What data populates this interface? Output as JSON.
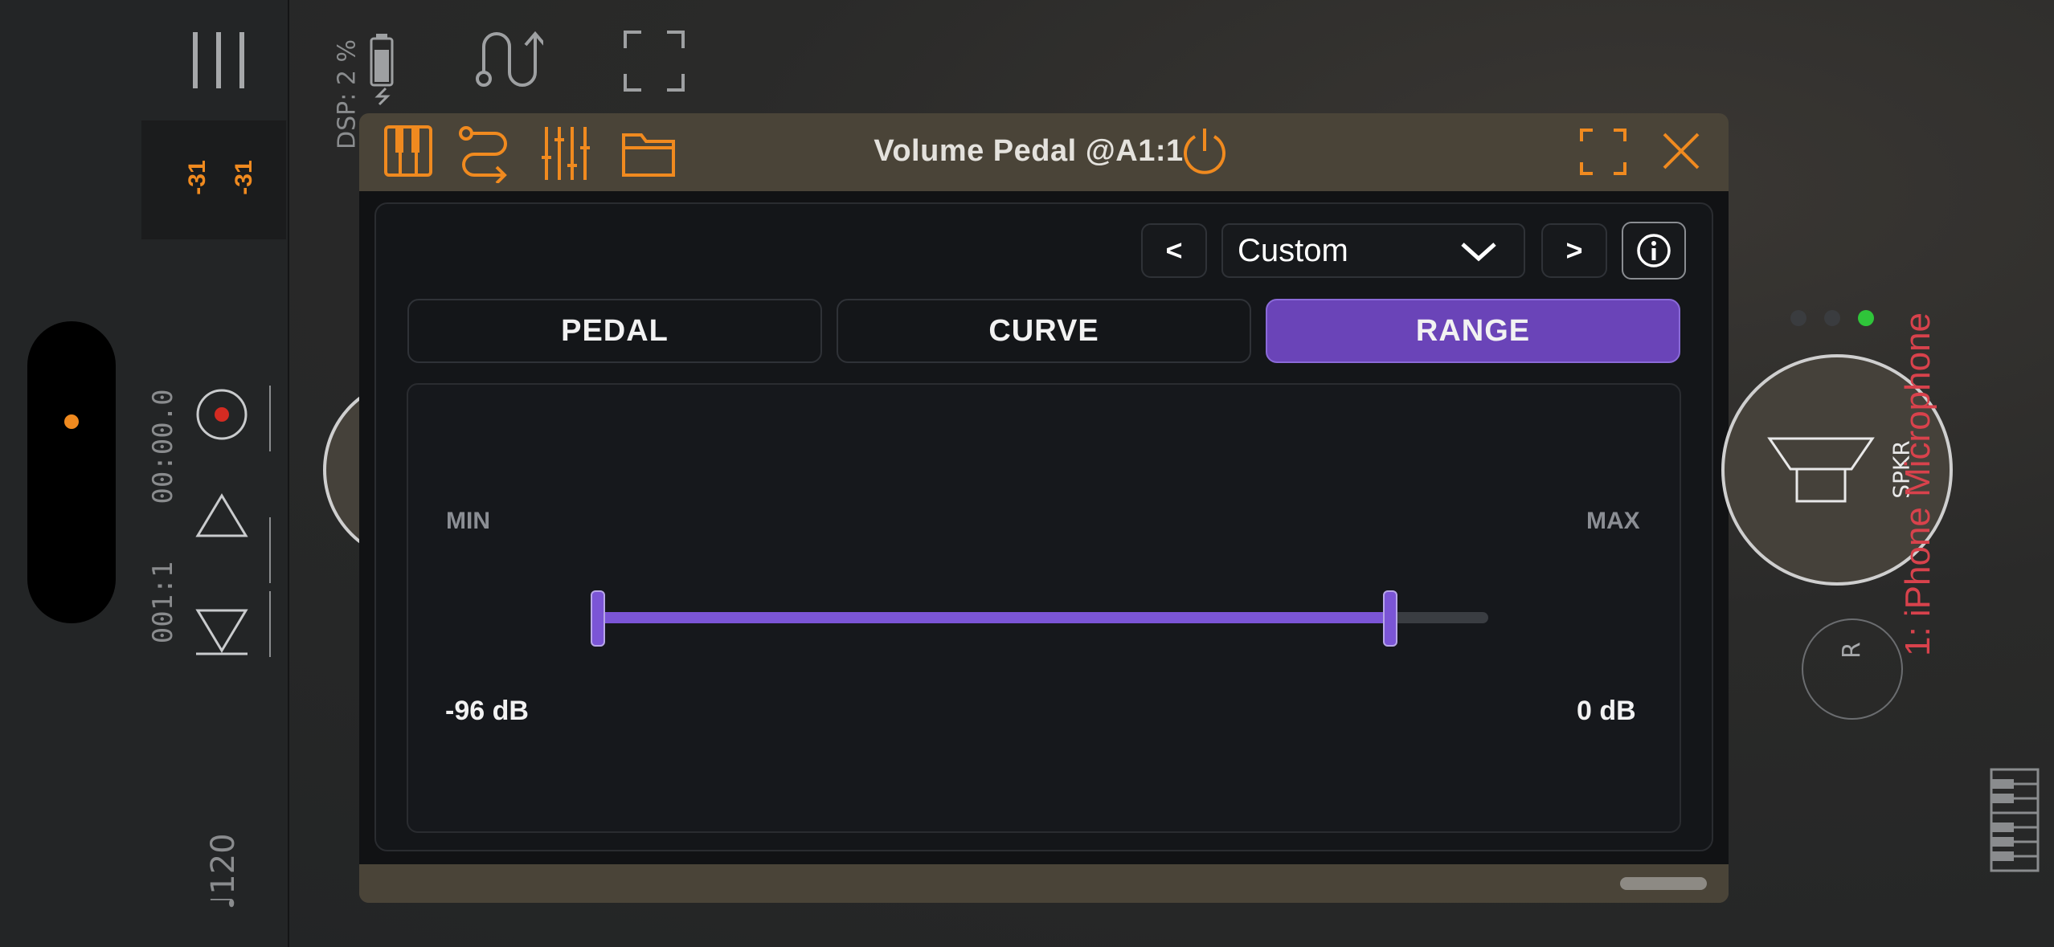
{
  "app": {
    "dsp_label": "DSP: 2 %",
    "meter_left": "-31",
    "meter_right": "-31",
    "time": "00:00.0",
    "position": "001:1",
    "tempo": "♩120"
  },
  "plugin": {
    "title": "Volume Pedal @A1:1",
    "preset": "Custom",
    "prev_label": "<",
    "next_label": ">",
    "tabs": [
      {
        "label": "PEDAL",
        "active": false
      },
      {
        "label": "CURVE",
        "active": false
      },
      {
        "label": "RANGE",
        "active": true
      }
    ],
    "range": {
      "min_label": "MIN",
      "max_label": "MAX",
      "min_value": "-96 dB",
      "max_value": "0 dB",
      "min_fraction": 0.0,
      "max_fraction": 0.89
    }
  },
  "output": {
    "speaker_label": "SPKR",
    "r_label": "R",
    "input_name": "1: iPhone Microphone"
  },
  "colors": {
    "accent_orange": "#f08a1f",
    "accent_purple": "#7b55d6",
    "input_red": "#d8424c",
    "active_green": "#2fc53a",
    "record_red": "#d42b22"
  }
}
